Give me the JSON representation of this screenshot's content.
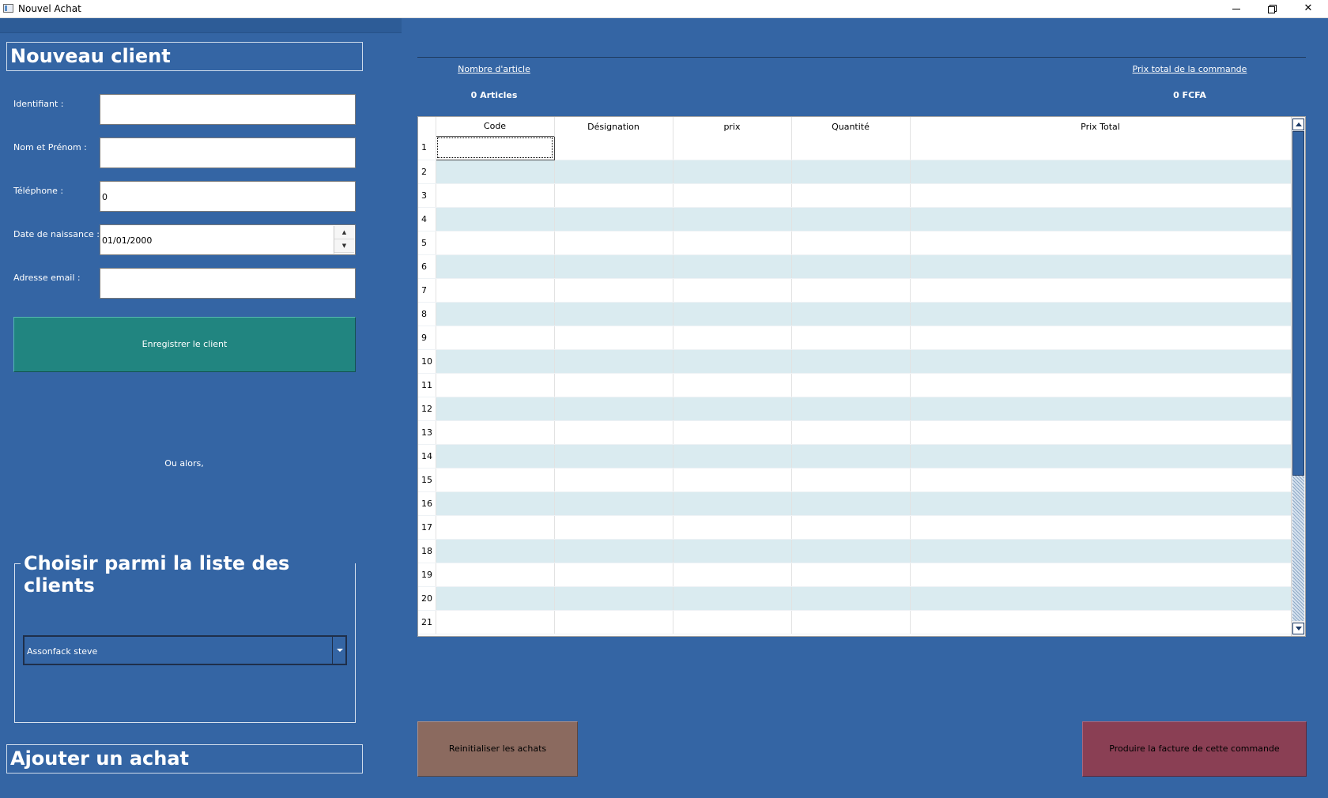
{
  "window": {
    "title": "Nouvel Achat"
  },
  "left_panel": {
    "new_client_title": "Nouveau client",
    "fields": {
      "id_label": "Identifiant :",
      "id_value": "",
      "name_label": "Nom et Prénom :",
      "name_value": "",
      "phone_label": "Téléphone :",
      "phone_value": "0",
      "birthdate_label": "Date de naissance :",
      "birthdate_value": "01/01/2000",
      "email_label": "Adresse email :",
      "email_value": ""
    },
    "save_button": "Enregistrer le client",
    "or_text": "Ou alors,",
    "choose_group_title": "Choisir parmi la liste des clients",
    "client_select_value": "Assonfack steve",
    "add_purchase_title": "Ajouter un achat"
  },
  "summary": {
    "article_count_label": "Nombre d'article",
    "article_count_value": "0 Articles",
    "total_price_label": "Prix total de la commande",
    "total_price_value": "0 FCFA"
  },
  "grid": {
    "columns": [
      "Code",
      "Désignation",
      "prix",
      "Quantité",
      "Prix Total"
    ],
    "row_numbers": [
      "1",
      "2",
      "3",
      "4",
      "5",
      "6",
      "7",
      "8",
      "9",
      "10",
      "11",
      "12",
      "13",
      "14",
      "15",
      "16",
      "17",
      "18",
      "19",
      "20",
      "21"
    ]
  },
  "buttons": {
    "reset": "Reinitialiser les achats",
    "invoice": "Produire la facture de cette commande"
  },
  "colors": {
    "background": "#3465a4",
    "save_button": "#218580",
    "reset_button": "#8b6a5f",
    "invoice_button": "#8a3f54",
    "grid_alt_row": "#daebf0"
  }
}
